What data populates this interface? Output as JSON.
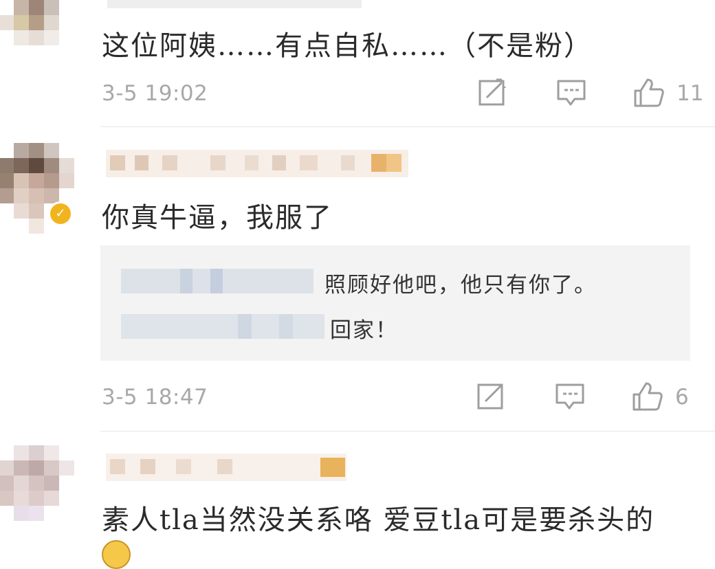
{
  "comments": [
    {
      "text": "这位阿姨……有点自私……（不是粉）",
      "timestamp": "3-5 19:02",
      "like_count": "11"
    },
    {
      "text": "你真牛逼，我服了",
      "quoted_reply": {
        "line1": "照顾好他吧，他只有你了。",
        "line2": "回家！"
      },
      "timestamp": "3-5 18:47",
      "like_count": "6"
    },
    {
      "text": "素人tla当然没关系咯 爱豆tla可是要杀头的"
    }
  ],
  "icons": {
    "repost": "repost-icon",
    "comment": "comment-icon",
    "like": "like-icon",
    "verified": "verified-badge-icon",
    "emoji": "emoji-icon"
  },
  "colors": {
    "meta_text": "#a8a8a8",
    "comment_text": "#2a2a2a",
    "verified_badge": "#f2b41e",
    "quote_background": "#f3f3f3",
    "divider": "#e6e6e6"
  }
}
